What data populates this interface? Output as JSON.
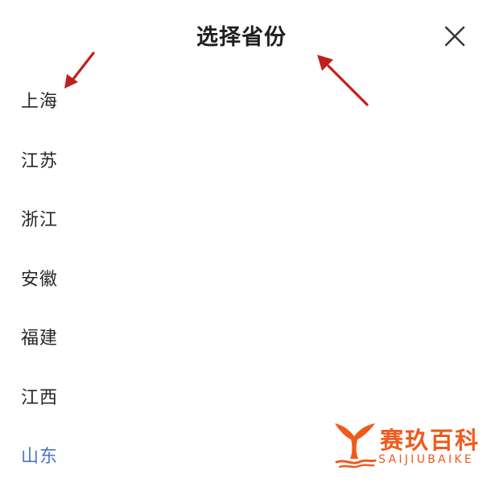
{
  "header": {
    "title": "选择省份"
  },
  "provinces": [
    {
      "label": "上海"
    },
    {
      "label": "江苏"
    },
    {
      "label": "浙江"
    },
    {
      "label": "安徽"
    },
    {
      "label": "福建"
    },
    {
      "label": "江西"
    },
    {
      "label": "山东"
    }
  ],
  "colors": {
    "accent": "#4f74c7",
    "annotation_arrow": "#c0201c",
    "watermark": "#ef5a1c"
  },
  "icons": {
    "close": "close-icon",
    "watermark_logo": "whale-tail-logo"
  },
  "watermark": {
    "name_cn": "赛玖百科",
    "name_en": "SAIJIUBAIKE"
  }
}
